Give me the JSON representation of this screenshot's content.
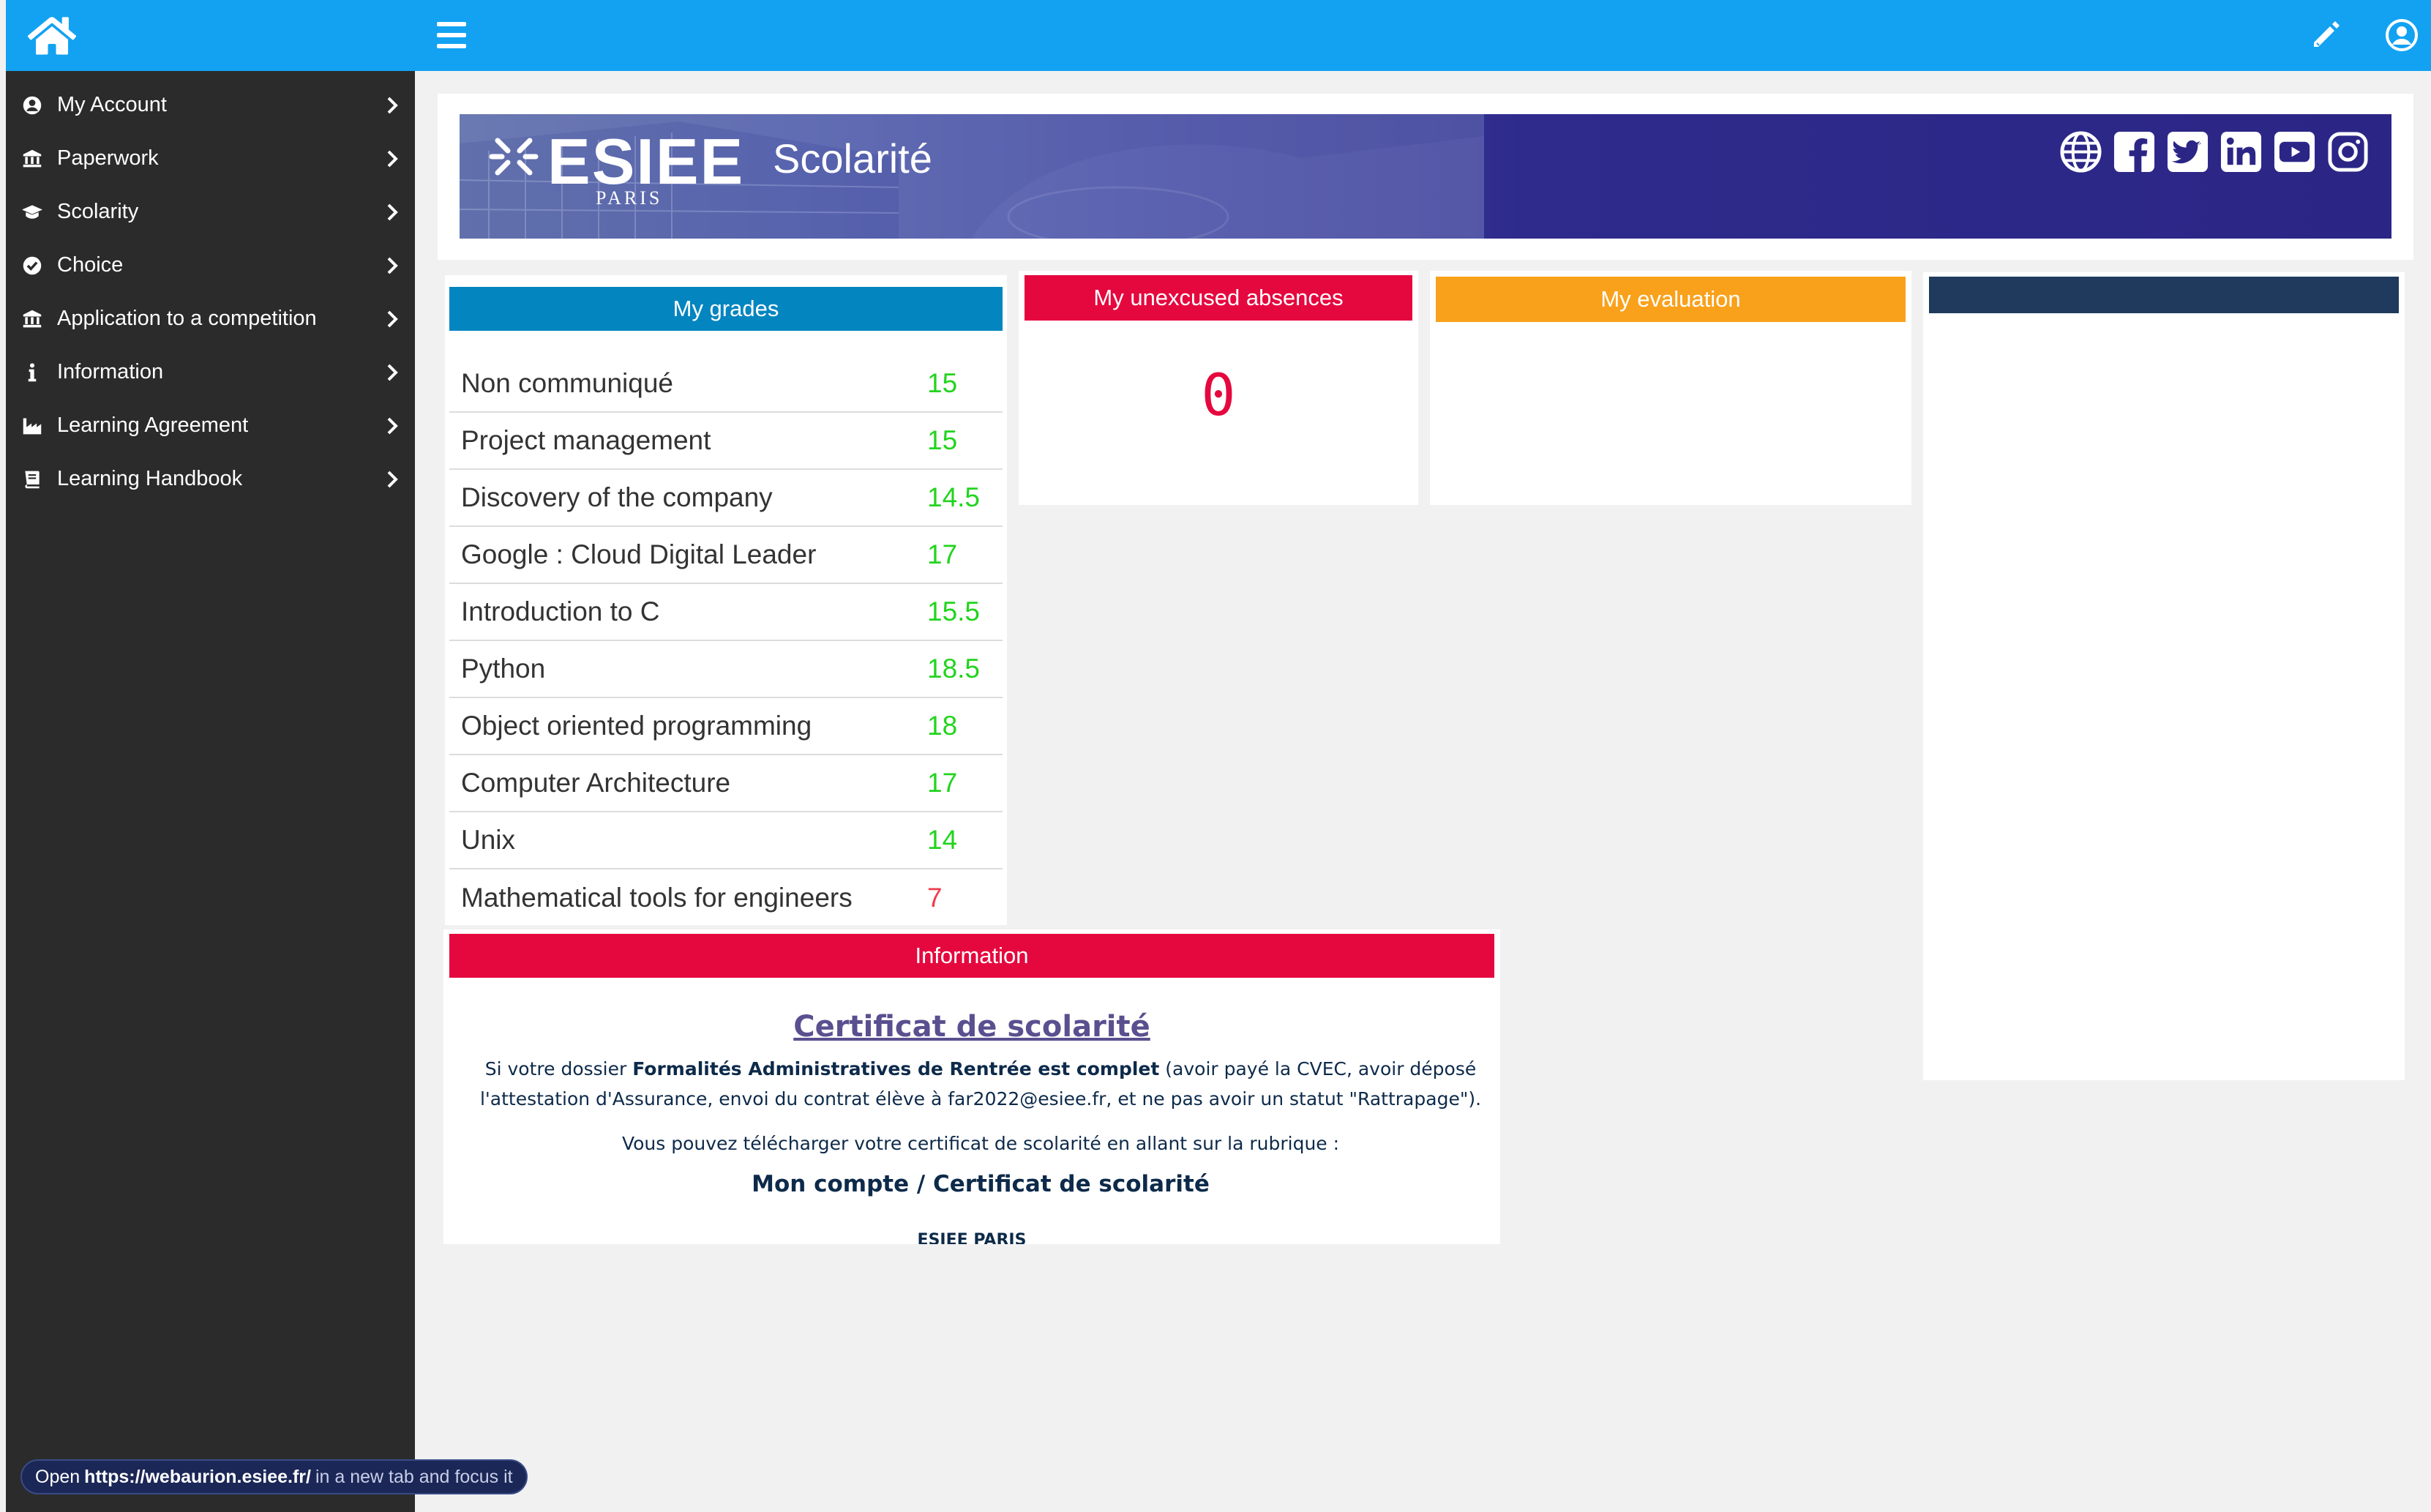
{
  "sidebar": {
    "items": [
      {
        "label": "My Account",
        "icon": "user-circle-icon"
      },
      {
        "label": "Paperwork",
        "icon": "bank-icon"
      },
      {
        "label": "Scolarity",
        "icon": "graduation-cap-icon"
      },
      {
        "label": "Choice",
        "icon": "check-circle-icon"
      },
      {
        "label": "Application to a competition",
        "icon": "bank-icon"
      },
      {
        "label": "Information",
        "icon": "info-icon"
      },
      {
        "label": "Learning Agreement",
        "icon": "industry-icon"
      },
      {
        "label": "Learning Handbook",
        "icon": "book-icon"
      }
    ]
  },
  "banner": {
    "logo": "ESIEE",
    "logo_sub": "PARIS",
    "title": "Scolarité"
  },
  "grades": {
    "header": "My grades",
    "rows": [
      {
        "course": "Non communiqué",
        "grade": "15"
      },
      {
        "course": "Project management",
        "grade": "15"
      },
      {
        "course": "Discovery of the company",
        "grade": "14.5"
      },
      {
        "course": "Google : Cloud Digital Leader",
        "grade": "17"
      },
      {
        "course": "Introduction to C",
        "grade": "15.5"
      },
      {
        "course": "Python",
        "grade": "18.5"
      },
      {
        "course": "Object oriented programming",
        "grade": "18"
      },
      {
        "course": "Computer Architecture",
        "grade": "17"
      },
      {
        "course": "Unix",
        "grade": "14"
      },
      {
        "course": "Mathematical tools for engineers",
        "grade": "7"
      }
    ],
    "pass_color": "#22d41e",
    "fail_color": "#f03c4a"
  },
  "absences": {
    "header": "My unexcused absences",
    "count": "0"
  },
  "evaluation": {
    "header": "My evaluation"
  },
  "information": {
    "header": "Information",
    "cert_title": "Certificat de scolarité",
    "para1_prefix": "Si votre dossier ",
    "para1_bold": "Formalités Administratives de Rentrée est complet",
    "para1_suffix": " (avoir payé la CVEC, avoir déposé",
    "para1_line2": "l'attestation d'Assurance, envoi du contrat élève à far2022@esiee.fr, et ne pas avoir un statut \"Rattrapage\").",
    "para2": "Vous pouvez télécharger votre certificat de scolarité en allant sur la rubrique :",
    "path": "Mon compte / Certificat de scolarité",
    "footer": "ESIEE PARIS"
  },
  "status_bar": {
    "prefix": "Open",
    "url": "https://webaurion.esiee.fr/",
    "suffix": "in a new tab and focus it"
  },
  "colors": {
    "topbar": "#13a2f2",
    "sidebar": "#2b2b2b",
    "grades_header": "#0385c0",
    "absences_header": "#e5083e",
    "evaluation_header": "#f9a11b",
    "dark_header": "#1f3a5c",
    "info_header": "#e5083e"
  }
}
